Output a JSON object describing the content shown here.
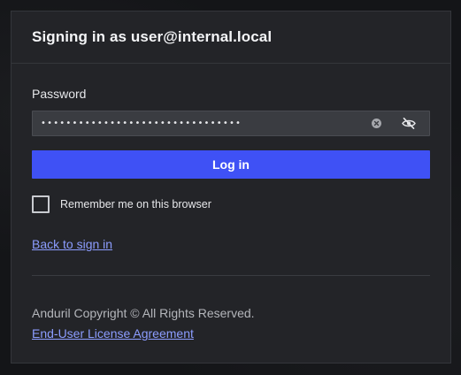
{
  "header": {
    "title": "Signing in as user@internal.local"
  },
  "password_field": {
    "label": "Password",
    "value": "••••••••••••••••••••••••••••••••"
  },
  "icons": {
    "clear": "clear-icon",
    "toggle_visibility": "eye-off-icon"
  },
  "login_button": {
    "label": "Log in",
    "color": "#3f51f5"
  },
  "remember": {
    "label": "Remember me on this browser",
    "checked": false
  },
  "links": {
    "back": "Back to sign in",
    "eula": "End-User License Agreement",
    "color": "#8c9dff"
  },
  "footer": {
    "copyright": "Anduril Copyright © All Rights Reserved."
  }
}
